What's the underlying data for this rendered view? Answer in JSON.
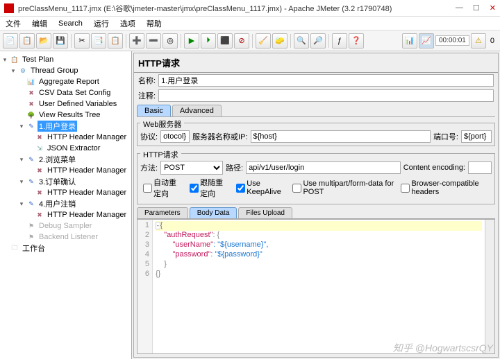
{
  "window": {
    "title": "preClassMenu_1117.jmx (E:\\谷歌\\jmeter-master\\jmx\\preClassMenu_1117.jmx) - Apache JMeter (3.2 r1790748)"
  },
  "menu": {
    "file": "文件",
    "edit": "编辑",
    "search": "Search",
    "run": "运行",
    "options": "选项",
    "help": "帮助"
  },
  "toolbar": {
    "timer": "00:00:01",
    "counter": "0"
  },
  "tree": {
    "testplan": "Test Plan",
    "threadgroup": "Thread Group",
    "aggregate": "Aggregate Report",
    "csv": "CSV Data Set Config",
    "vars": "User Defined Variables",
    "results": "View Results Tree",
    "r1": "1.用户登录",
    "r1_hdr": "HTTP Header Manager",
    "r1_json": "JSON Extractor",
    "r2": "2.浏览菜单",
    "r2_hdr": "HTTP Header Manager",
    "r3": "3.订单确认",
    "r3_hdr": "HTTP Header Manager",
    "r4": "4.用户注销",
    "r4_hdr": "HTTP Header Manager",
    "debug": "Debug Sampler",
    "backend": "Backend Listener",
    "workbench": "工作台"
  },
  "panel": {
    "title": "HTTP请求",
    "name_label": "名称:",
    "name_value": "1.用户登录",
    "comment_label": "注释:",
    "tab_basic": "Basic",
    "tab_advanced": "Advanced",
    "webserver_title": "Web服务器",
    "protocol_label": "协议:",
    "protocol_value": "otocol}",
    "server_label": "服务器名称或IP:",
    "server_value": "${host}",
    "port_label": "端口号:",
    "port_value": "${port}",
    "http_title": "HTTP请求",
    "method_label": "方法:",
    "method_value": "POST",
    "path_label": "路径:",
    "path_value": "api/v1/user/login",
    "encoding_label": "Content encoding:",
    "cb_auto_redirect": "自动重定向",
    "cb_follow_redirect": "跟随重定向",
    "cb_keepalive": "Use KeepAlive",
    "cb_multipart": "Use multipart/form-data for POST",
    "cb_browser": "Browser-compatible headers",
    "subtab_params": "Parameters",
    "subtab_body": "Body Data",
    "subtab_files": "Files Upload",
    "code": {
      "l1": "{",
      "l2_k": "\"authRequest\"",
      "l2_b": ": {",
      "l3_k": "\"userName\"",
      "l3_v": ": \"${username}\",",
      "l4_k": "\"password\"",
      "l4_v": ": \"${password}\"",
      "l5": "    }",
      "l6": "{}"
    }
  },
  "watermark": "知乎 @HogwartscsrQY"
}
